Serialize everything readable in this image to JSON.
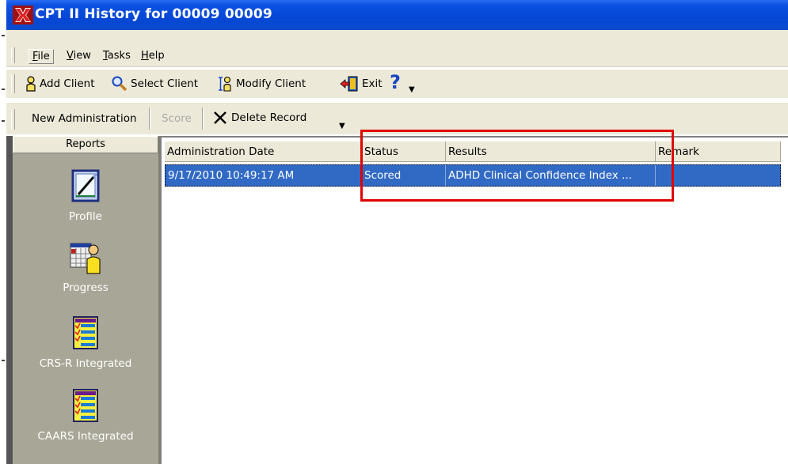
{
  "window": {
    "title": "CPT II History for 00009 00009"
  },
  "menu": [
    {
      "label": "File"
    },
    {
      "label": "View"
    },
    {
      "label": "Tasks"
    },
    {
      "label": "Help"
    }
  ],
  "toolbar1": {
    "add_client": "Add Client",
    "select_client": "Select Client",
    "modify_client": "Modify Client",
    "exit": "Exit",
    "help_glyph": "?"
  },
  "toolbar2": {
    "new_admin": "New Administration",
    "score": "Score",
    "delete_record": "Delete Record"
  },
  "reports": {
    "header": "Reports",
    "items": [
      {
        "label": "Profile",
        "icon": "profile-report-icon"
      },
      {
        "label": "Progress",
        "icon": "progress-report-icon"
      },
      {
        "label": "CRS-R Integrated",
        "icon": "crs-r-report-icon"
      },
      {
        "label": "CAARS Integrated",
        "icon": "caars-report-icon"
      }
    ]
  },
  "table": {
    "columns": [
      "Administration Date",
      "Status",
      "Results",
      "Remark"
    ],
    "rows": [
      {
        "date": "9/17/2010 10:49:17 AM",
        "status": "Scored",
        "results": "ADHD Clinical Confidence Index ...",
        "remark": ""
      }
    ]
  },
  "colors": {
    "titlebar": "#0546d6",
    "selection": "#316ac5",
    "annotation": "#e00000",
    "panel": "#a8a696"
  }
}
